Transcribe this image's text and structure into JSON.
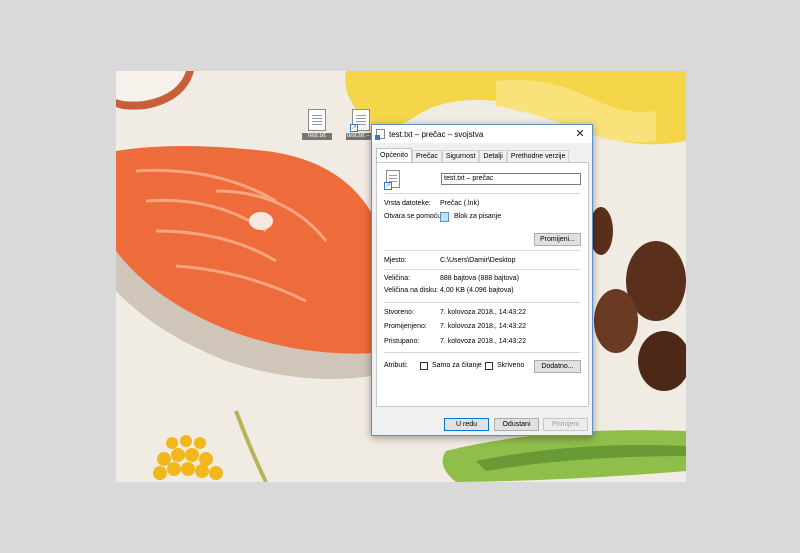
{
  "desktop": {
    "icons": [
      {
        "label": "test.txt"
      },
      {
        "label": "test.txt – prečac"
      }
    ]
  },
  "dialog": {
    "title": "test.txt – prečac – svojstva",
    "close_glyph": "✕",
    "tabs": [
      {
        "label": "Općenito"
      },
      {
        "label": "Prečac"
      },
      {
        "label": "Sigurnost"
      },
      {
        "label": "Detalji"
      },
      {
        "label": "Prethodne verzije"
      }
    ],
    "name_value": "test.txt – prečac",
    "file_type_label": "Vrsta datoteke:",
    "file_type_value": "Prečac (.lnk)",
    "opens_with_label": "Otvara se pomoću:",
    "opens_with_value": "Blok za pisanje",
    "change_button": "Promijeni...",
    "location_label": "Mjesto:",
    "location_value": "C:\\Users\\Damir\\Desktop",
    "size_label": "Veličina:",
    "size_value": "888 bajtova (888 bajtova)",
    "size_on_disk_label": "Veličina na disku:",
    "size_on_disk_value": "4,00 KB (4.096 bajtova)",
    "created_label": "Stvoreno:",
    "created_value": "7. kolovoza 2018., 14:43:22",
    "modified_label": "Promijenjeno:",
    "modified_value": "7. kolovoza 2018., 14:43:22",
    "accessed_label": "Pristupano:",
    "accessed_value": "7. kolovoza 2018., 14:43:22",
    "attributes_label": "Atributi:",
    "readonly_label": "Samo za čitanje",
    "hidden_label": "Skriveno",
    "advanced_button": "Dodatno...",
    "ok_button": "U redu",
    "cancel_button": "Odustani",
    "apply_button": "Primijeni"
  },
  "colors": {
    "accent": "#0078d7",
    "window_border": "#5a8fc9",
    "salmon": "#ee6b3b"
  }
}
